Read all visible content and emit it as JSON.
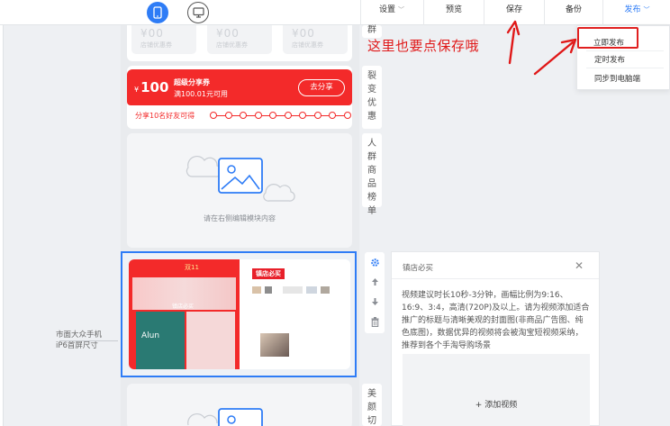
{
  "topbar": {
    "nav": [
      {
        "label": "设置",
        "has_caret": true
      },
      {
        "label": "预览"
      },
      {
        "label": "保存"
      },
      {
        "label": "备份"
      },
      {
        "label": "发布",
        "has_caret": true
      }
    ],
    "device_modes": [
      "mobile-icon",
      "desktop-icon"
    ]
  },
  "canvas": {
    "coupons": [
      {
        "value": "¥00",
        "label": "店铺优惠券"
      },
      {
        "value": "¥00",
        "label": "店铺优惠券"
      },
      {
        "value": "¥00",
        "label": "店铺优惠券"
      }
    ],
    "share_coupon": {
      "currency": "¥",
      "amount": "100",
      "title": "超级分享券",
      "condition": "满100.01元可用",
      "button": "去分享",
      "progress_label": "分享10名好友可得",
      "progress_dots": 10
    },
    "placeholder_text": "请在右侧编辑模块内容",
    "video_module": {
      "tag": "镇店必买",
      "phone_texts": [
        "双11",
        "镇店必买",
        "Alun"
      ]
    },
    "side_label": [
      "市面大众手机",
      "iP6首屏尺寸"
    ]
  },
  "side_tabs": [
    {
      "label": "群"
    },
    {
      "label": "裂变优惠"
    },
    {
      "label": "人群商品榜单"
    },
    {
      "label": "美颜切图"
    }
  ],
  "tools": [
    "gear-icon",
    "arrow-up-icon",
    "arrow-down-icon",
    "trash-icon"
  ],
  "editor": {
    "title": "镇店必买",
    "description": "视频建议时长10秒-3分钟，画幅比例为9:16、16:9、3:4，高清(720P)及以上。请为视频添加适合推广的标题与清晰美观的封面图(非商品广告图、纯色底图)，数据优异的视频将会被淘宝短视频采纳，推荐到各个手淘导购场景",
    "upload_label": "+ 添加视频"
  },
  "publish_menu": {
    "items": [
      "立即发布",
      "定时发布",
      "同步到电脑端"
    ]
  },
  "annotation": {
    "text": "这里也要点保存哦"
  },
  "colors": {
    "accent": "#2e7cf6",
    "red": "#f32a2a",
    "annotation": "#e01818"
  }
}
